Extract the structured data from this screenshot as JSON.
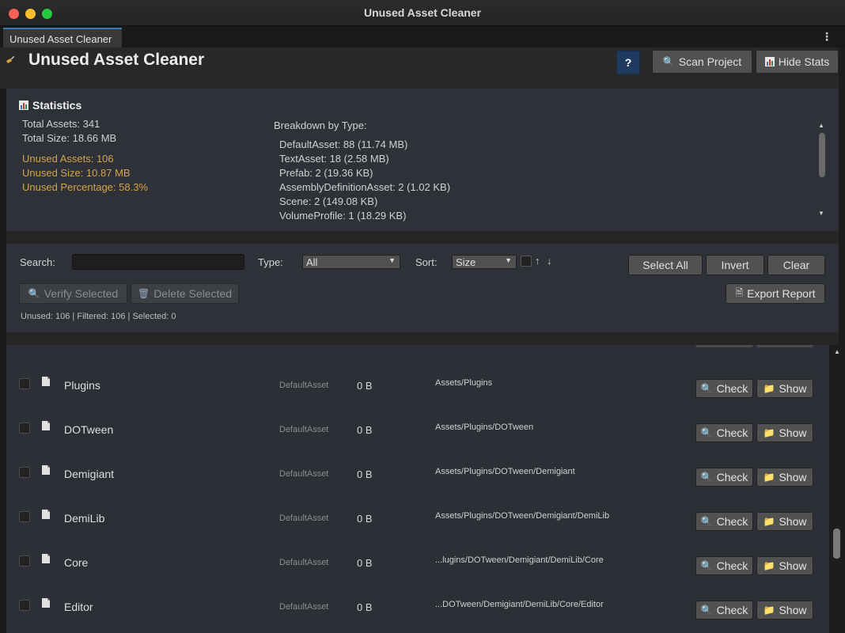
{
  "window": {
    "title": "Unused Asset Cleaner"
  },
  "tab": {
    "label": "Unused Asset Cleaner"
  },
  "header": {
    "title": "Unused Asset Cleaner",
    "help_label": "?",
    "scan_label": "Scan Project",
    "hide_stats_label": "Hide Stats",
    "icons": {
      "title": "broom-icon",
      "scan": "magnifier-icon",
      "stats": "bar-chart-icon"
    }
  },
  "stats": {
    "title": "Statistics",
    "total_assets": "Total Assets: 341",
    "total_size": "Total Size: 18.66 MB",
    "unused_assets": "Unused Assets: 106",
    "unused_size": "Unused Size: 10.87 MB",
    "unused_percentage": "Unused Percentage: 58.3%",
    "breakdown_title": "Breakdown by Type:",
    "breakdown": [
      "DefaultAsset: 88 (11.74 MB)",
      "TextAsset: 18 (2.58 MB)",
      "Prefab: 2 (19.36 KB)",
      "AssemblyDefinitionAsset: 2 (1.02 KB)",
      "Scene: 2 (149.08 KB)",
      "VolumeProfile: 1 (18.29 KB)"
    ],
    "warn_color": "#d4a34a"
  },
  "controls": {
    "search_label": "Search:",
    "search_value": "",
    "type_label": "Type:",
    "type_value": "All",
    "sort_label": "Sort:",
    "sort_value": "Size",
    "sort_asc": "↑",
    "sort_desc": "↓",
    "select_all": "Select All",
    "invert": "Invert",
    "clear": "Clear",
    "verify_selected": "Verify Selected",
    "delete_selected": "Delete Selected",
    "export_report": "Export Report",
    "summary": "Unused: 106 | Filtered: 106 | Selected: 0"
  },
  "list": {
    "check_label": "Check",
    "show_label": "Show",
    "rows": [
      {
        "name": "Plugins",
        "type": "DefaultAsset",
        "size": "0 B",
        "path": "Assets/Plugins"
      },
      {
        "name": "DOTween",
        "type": "DefaultAsset",
        "size": "0 B",
        "path": "Assets/Plugins/DOTween"
      },
      {
        "name": "Demigiant",
        "type": "DefaultAsset",
        "size": "0 B",
        "path": "Assets/Plugins/DOTween/Demigiant"
      },
      {
        "name": "DemiLib",
        "type": "DefaultAsset",
        "size": "0 B",
        "path": "Assets/Plugins/DOTween/Demigiant/DemiLib"
      },
      {
        "name": "Core",
        "type": "DefaultAsset",
        "size": "0 B",
        "path": "...lugins/DOTween/Demigiant/DemiLib/Core"
      },
      {
        "name": "Editor",
        "type": "DefaultAsset",
        "size": "0 B",
        "path": "...DOTween/Demigiant/DemiLib/Core/Editor"
      }
    ]
  }
}
